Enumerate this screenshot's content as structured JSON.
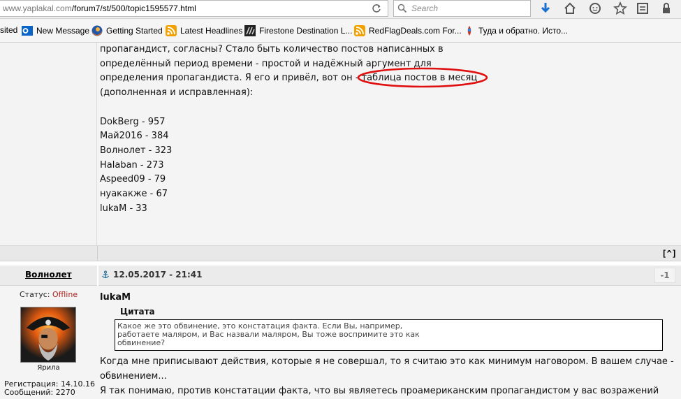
{
  "browser": {
    "url_host": "www.yaplakal.com",
    "url_path": "/forum7/st/500/topic1595577.html",
    "search_placeholder": "Search",
    "bookmarks": [
      {
        "label": "sited",
        "icon": "none"
      },
      {
        "label": "New Message",
        "icon": "outlook-icon"
      },
      {
        "label": "Getting Started",
        "icon": "firefox-icon"
      },
      {
        "label": "Latest Headlines",
        "icon": "rss-icon"
      },
      {
        "label": "Firestone Destination L...",
        "icon": "firestone-icon"
      },
      {
        "label": "RedFlagDeals.com For...",
        "icon": "rss-icon"
      },
      {
        "label": "Туда и обратно. Исто...",
        "icon": "site-icon"
      }
    ]
  },
  "post1": {
    "lines": [
      "пропагандист, согласны? Стало быть количество постов написанных в",
      "определённый период времени - простой и надёжный аргумент для",
      "определения пропагандиста. Я его и привёл, вот он - таблица постов в месяц",
      "(дополненная и исправленная):"
    ],
    "stats": [
      "DokBerg - 957",
      "Май2016 - 384",
      "Волнолет - 323",
      "Halaban - 273",
      "Aspeed09 - 79",
      "нуакакже - 67",
      "lukaM - 33"
    ],
    "top_button": "[^]"
  },
  "post2": {
    "author": "Волнолет",
    "date": "12.05.2017 - 21:41",
    "rating": "-1",
    "status_label": "Статус:",
    "status_value": "Offline",
    "rank": "Ярила",
    "registration": "Регистрация: 14.10.16",
    "posts": "Сообщений: 2270",
    "quote_author": "lukaM",
    "quote_title": "Цитата",
    "quote_lines": [
      "Какое же это обвинение, это констатация факта. Если Вы, например,",
      "работаете маляром, и Вас назвали маляром, Вы тоже воспримите это как",
      "обвинение?"
    ],
    "reply_lines": [
      "Когда мне приписывают действия, которые я не совершал, то я считаю это как минимум наговором. В вашем случае -",
      "обвинением...",
      "Я так понимаю, против констатации факта, что вы являетесь проамериканским пропагандистом у вас возражений"
    ]
  },
  "colors": {
    "highlight": "#e01010",
    "offline": "#b02020"
  }
}
